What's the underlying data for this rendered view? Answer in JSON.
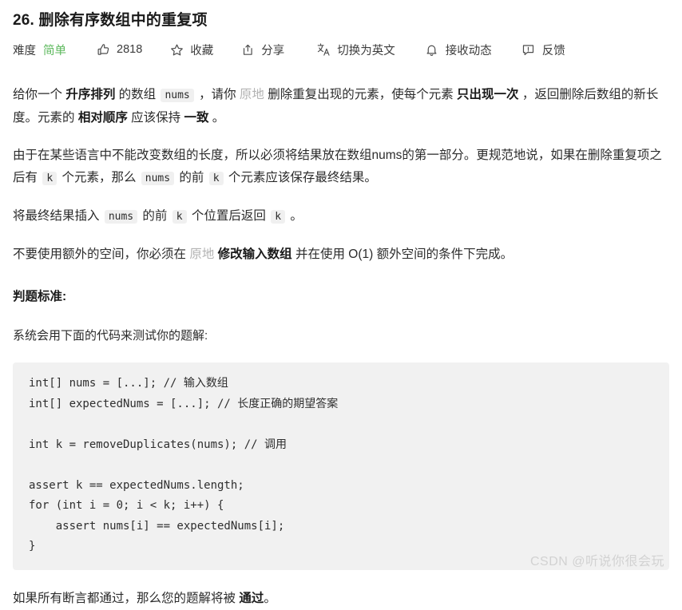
{
  "problem": {
    "title": "26. 删除有序数组中的重复项"
  },
  "meta": {
    "difficulty_label": "难度",
    "difficulty_value": "简单",
    "difficulty_color": "#5cb85c",
    "like_icon": "thumbs-up-icon",
    "like_count": "2818",
    "favorite_icon": "star-icon",
    "favorite_label": "收藏",
    "share_icon": "share-icon",
    "share_label": "分享",
    "translate_icon": "translate-icon",
    "translate_label": "切换为英文",
    "subscribe_icon": "bell-icon",
    "subscribe_label": "接收动态",
    "feedback_icon": "feedback-icon",
    "feedback_label": "反馈"
  },
  "paragraph1": {
    "t1": "给你一个 ",
    "b1": "升序排列",
    "t2": " 的数组 ",
    "code1": "nums",
    "t3": " ，请你 ",
    "link1": "原地",
    "t4": " 删除重复出现的元素，使每个元素 ",
    "b2": "只出现一次",
    "t5": " ，返回删除后数组的新长度。元素的 ",
    "b3": "相对顺序",
    "t6": " 应该保持 ",
    "b4": "一致",
    "t7": " 。"
  },
  "paragraph2": {
    "t1": "由于在某些语言中不能改变数组的长度，所以必须将结果放在数组nums的第一部分。更规范地说，如果在删除重复项之后有 ",
    "code1": "k",
    "t2": " 个元素，那么 ",
    "code2": "nums",
    "t3": " 的前 ",
    "code3": "k",
    "t4": " 个元素应该保存最终结果。"
  },
  "paragraph3": {
    "t1": "将最终结果插入 ",
    "code1": "nums",
    "t2": " 的前 ",
    "code2": "k",
    "t3": " 个位置后返回 ",
    "code3": "k",
    "t4": " 。"
  },
  "paragraph4": {
    "t1": "不要使用额外的空间，你必须在 ",
    "link1": "原地",
    "t2": " ",
    "b1": "修改输入数组",
    "t3": " 并在使用 O(1) 额外空间的条件下完成。"
  },
  "judge": {
    "section_title": "判题标准:",
    "lead": "系统会用下面的代码来测试你的题解:",
    "code": "int[] nums = [...]; // 输入数组\nint[] expectedNums = [...]; // 长度正确的期望答案\n\nint k = removeDuplicates(nums); // 调用\n\nassert k == expectedNums.length;\nfor (int i = 0; i < k; i++) {\n    assert nums[i] == expectedNums[i];\n}"
  },
  "outro": {
    "t1": "如果所有断言都通过，那么您的题解将被 ",
    "b1": "通过",
    "t2": "。"
  },
  "watermark": {
    "text": "CSDN @听说你很会玩"
  }
}
